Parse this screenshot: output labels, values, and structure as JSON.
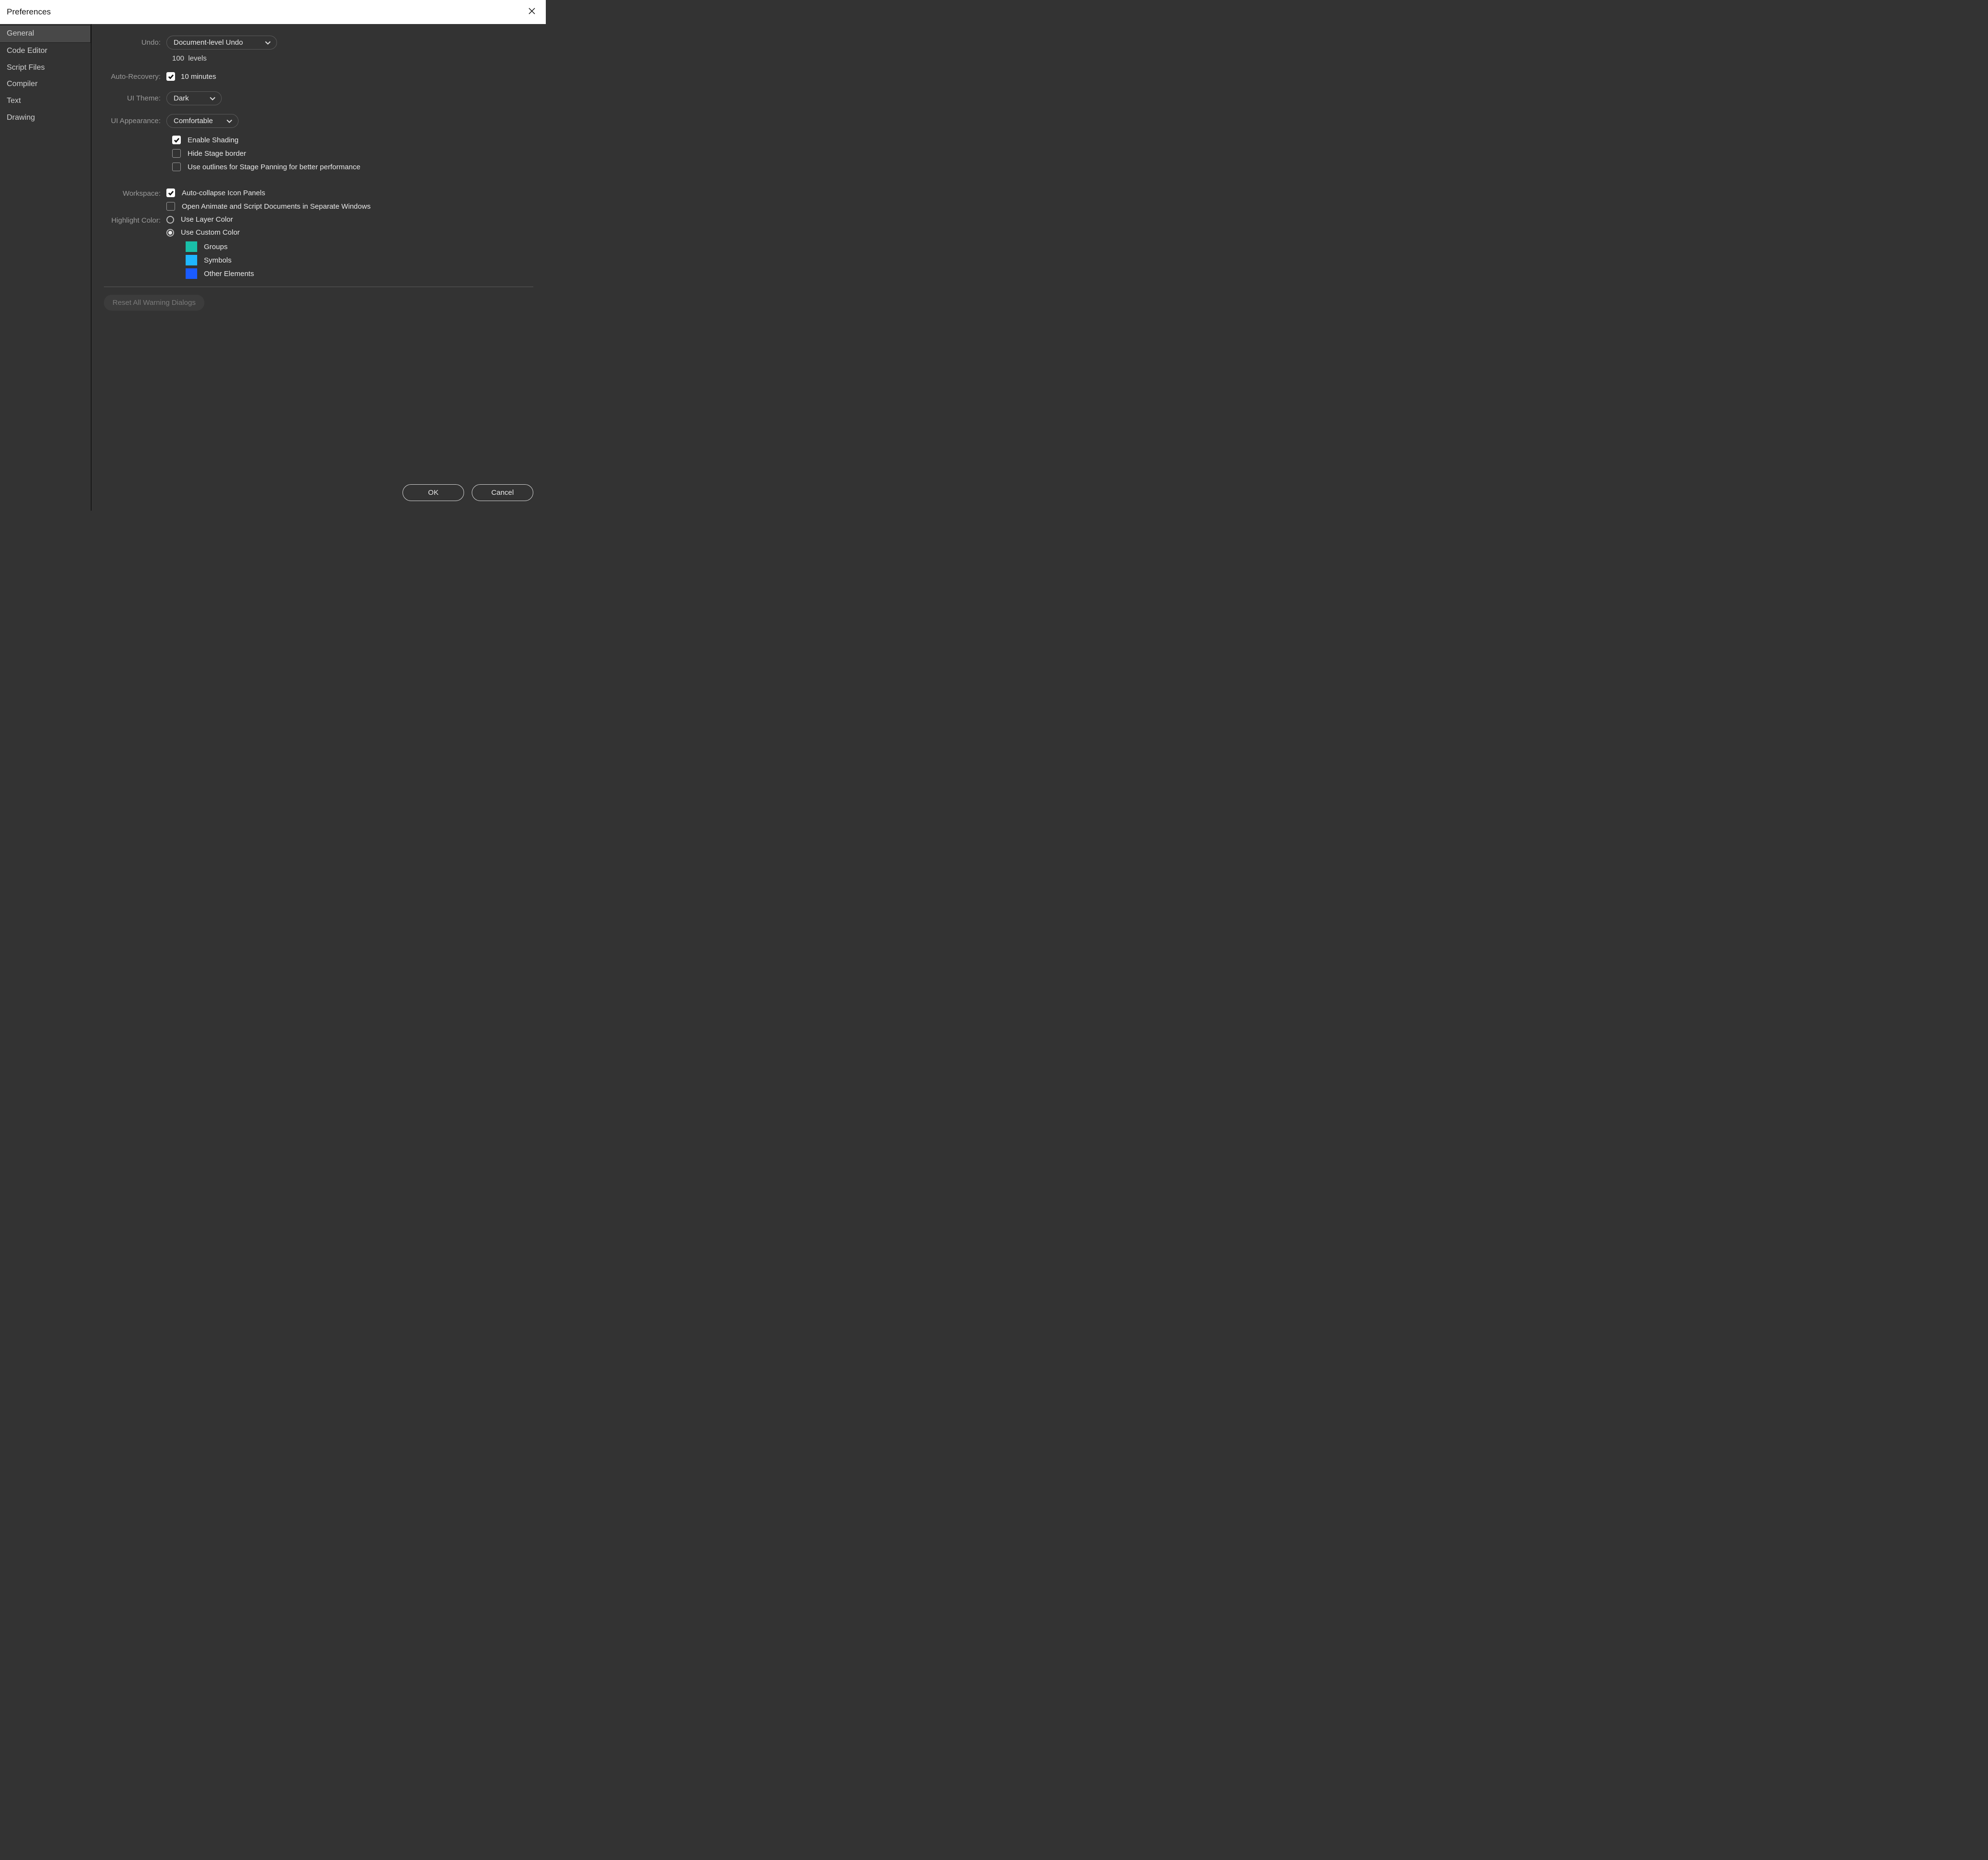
{
  "window": {
    "title": "Preferences"
  },
  "sidebar": {
    "items": [
      {
        "label": "General",
        "selected": true
      },
      {
        "label": "Code Editor",
        "selected": false
      },
      {
        "label": "Script Files",
        "selected": false
      },
      {
        "label": "Compiler",
        "selected": false
      },
      {
        "label": "Text",
        "selected": false
      },
      {
        "label": "Drawing",
        "selected": false
      }
    ]
  },
  "labels": {
    "undo": "Undo:",
    "auto_recovery": "Auto-Recovery:",
    "ui_theme": "UI Theme:",
    "ui_appearance": "UI Appearance:",
    "workspace": "Workspace:",
    "highlight": "Highlight Color:"
  },
  "undo": {
    "selected": "Document-level Undo",
    "levels_value": "100",
    "levels_word": "levels"
  },
  "autorecovery": {
    "checked": true,
    "value": "10 minutes"
  },
  "theme": {
    "selected": "Dark"
  },
  "appearance": {
    "selected": "Comfortable",
    "enable_shading": {
      "checked": true,
      "label": "Enable Shading"
    },
    "hide_stage_border": {
      "checked": false,
      "label": "Hide Stage border"
    },
    "use_outlines": {
      "checked": false,
      "label": "Use outlines for Stage Panning for better performance"
    }
  },
  "workspace": {
    "auto_collapse": {
      "checked": true,
      "label": "Auto-collapse Icon Panels"
    },
    "separate_windows": {
      "checked": false,
      "label": "Open Animate and Script Documents in Separate Windows"
    }
  },
  "highlight": {
    "use_layer": {
      "label": "Use Layer Color"
    },
    "use_custom": {
      "label": "Use Custom Color"
    },
    "selected": "custom",
    "groups": {
      "label": "Groups",
      "color": "#19bfa8"
    },
    "symbols": {
      "label": "Symbols",
      "color": "#1fb6ff"
    },
    "other": {
      "label": "Other Elements",
      "color": "#1a5bff"
    }
  },
  "buttons": {
    "reset": "Reset All Warning Dialogs",
    "ok": "OK",
    "cancel": "Cancel"
  }
}
